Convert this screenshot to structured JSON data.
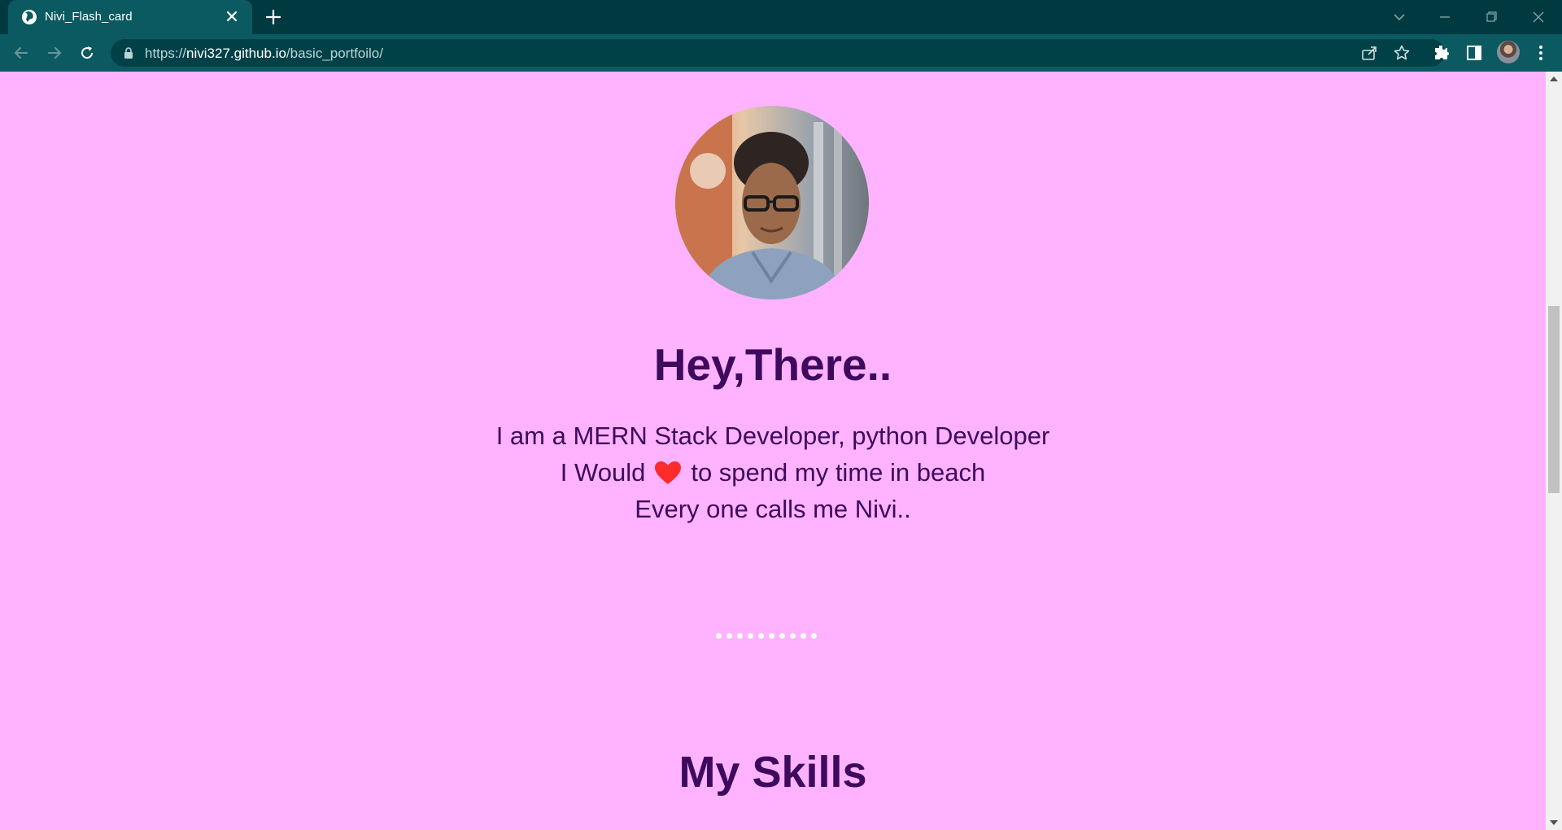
{
  "browser": {
    "tab_title": "Nivi_Flash_card",
    "url_prefix": "https://",
    "url_host": "nivi327.github.io",
    "url_path": "/basic_portfoilo/"
  },
  "page": {
    "greeting": "Hey,There..",
    "bio_line1": "I am a MERN Stack Developer, python Developer",
    "bio_line2_before": "I Would",
    "bio_line2_after": "to spend my time in beach",
    "bio_line3": "Every one calls me Nivi..",
    "skills_title": "My Skills",
    "carousel_dot_count": 10
  },
  "colors": {
    "page_background": "#ffb3ff",
    "heading": "#3d0a5e",
    "heart": "#ff2a2a",
    "chrome_dark": "#003a40",
    "chrome_toolbar": "#0b5a61"
  },
  "icons": {
    "tab": "globe-icon",
    "heart": "heart-icon"
  }
}
